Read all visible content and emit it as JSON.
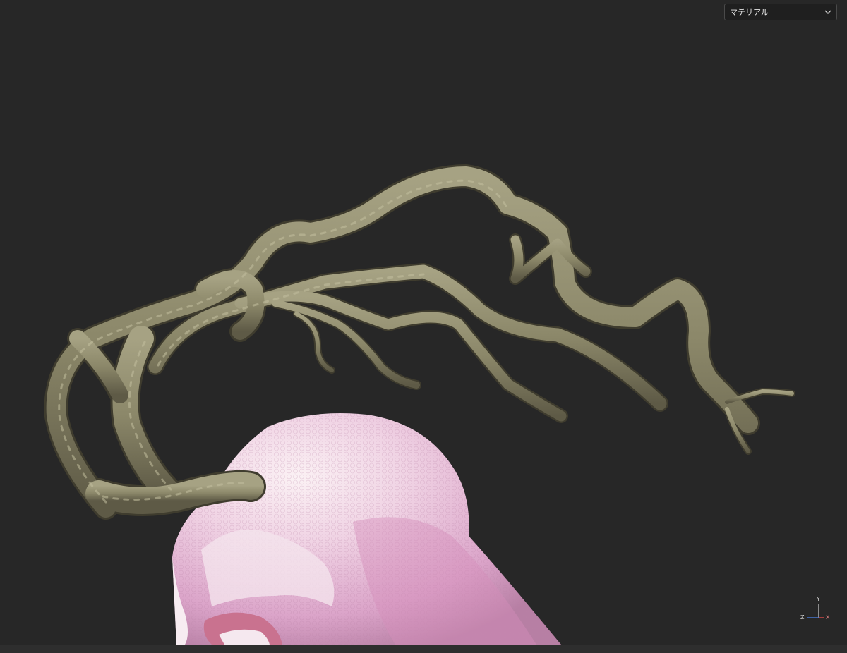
{
  "viewport": {
    "mode_select": {
      "selected": "マテリアル",
      "icon": "chevron-down-icon"
    },
    "axis_gizmo": {
      "y": "Y",
      "z": "Z",
      "x": "X",
      "colors": {
        "x": "#d94a4a",
        "y": "#cfcfcf",
        "z": "#4a7bd9"
      }
    },
    "colors": {
      "background": "#272727",
      "branch": "#8f8b6f",
      "skin": "#e9c9df"
    }
  }
}
